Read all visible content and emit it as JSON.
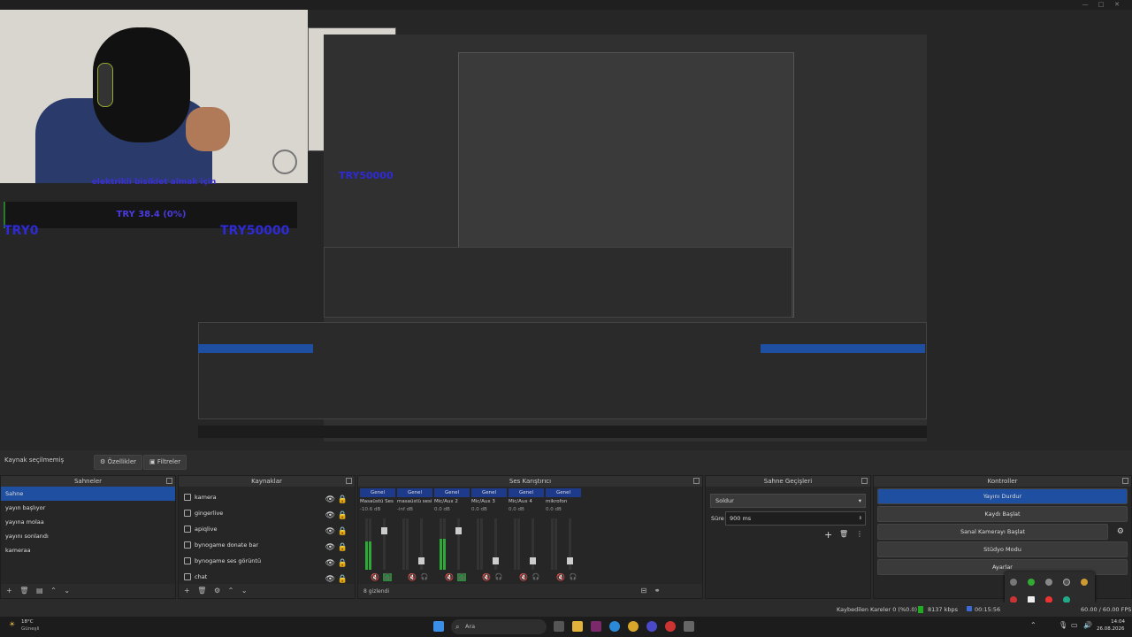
{
  "window": {
    "buttons": [
      "—",
      "□",
      "✕"
    ]
  },
  "preview": {
    "alert_text": "elektrikli bisiklet almak için",
    "goal_bar": "TRY 38.4 (0%)",
    "left_amount": "TRY0",
    "right_amount": "TRY50000"
  },
  "source_bar": {
    "no_source": "Kaynak seçilmemiş",
    "properties": "Özellikler",
    "filters": "Filtreler"
  },
  "scenes": {
    "title": "Sahneler",
    "items": [
      "Sahne",
      "yayın başlıyor",
      "yayına molaa",
      "yayını sonlandı",
      "kameraa"
    ],
    "selected": 0
  },
  "sources": {
    "title": "Kaynaklar",
    "items": [
      "kamera",
      "gingerlive",
      "apiqlive",
      "bynogame donate bar",
      "bynogame ses görüntü",
      "chat"
    ]
  },
  "mixer": {
    "title": "Ses Karıştırıcı",
    "channels": [
      {
        "header": "Genel",
        "name": "Masaüstü Ses 2",
        "db": "-10.6 dB",
        "level": 0.55,
        "color": "#2fa83a"
      },
      {
        "header": "Genel",
        "name": "masaüstü sesi",
        "db": "-inf dB",
        "level": 0.0,
        "color": "#555555"
      },
      {
        "header": "Genel",
        "name": "Mic/Aux 2",
        "db": "0.0 dB",
        "level": 0.6,
        "color": "#2fa83a"
      },
      {
        "header": "Genel",
        "name": "Mic/Aux 3",
        "db": "0.0 dB",
        "level": 0.0,
        "color": "#555555"
      },
      {
        "header": "Genel",
        "name": "Mic/Aux 4",
        "db": "0.0 dB",
        "level": 0.0,
        "color": "#555555"
      },
      {
        "header": "Genel",
        "name": "mikrofon",
        "db": "0.0 dB",
        "level": 0.0,
        "color": "#555555"
      }
    ],
    "hidden": "8 gizlendi",
    "options": "Seçenekler"
  },
  "transitions": {
    "title": "Sahne Geçişleri",
    "type": "Soldur",
    "duration_label": "Süre",
    "duration": "900 ms"
  },
  "controls": {
    "title": "Kontroller",
    "stop_stream": "Yayını Durdur",
    "start_record": "Kaydı Başlat",
    "virtual_cam": "Sanal Kamerayı Başlat",
    "studio": "Stüdyo Modu",
    "settings": "Ayarlar"
  },
  "status": {
    "dropped": "Kaybedilen Kareler 0 (%0.0)",
    "bitrate": "8137 kbps",
    "time": "00:15:56",
    "fps": "60.00 / 60.00 FPS"
  },
  "taskbar": {
    "weather_temp": "18°C",
    "weather_desc": "Güneşli",
    "search": "Ara",
    "clock_time": "14:04",
    "clock_date": "26.08.2026"
  }
}
